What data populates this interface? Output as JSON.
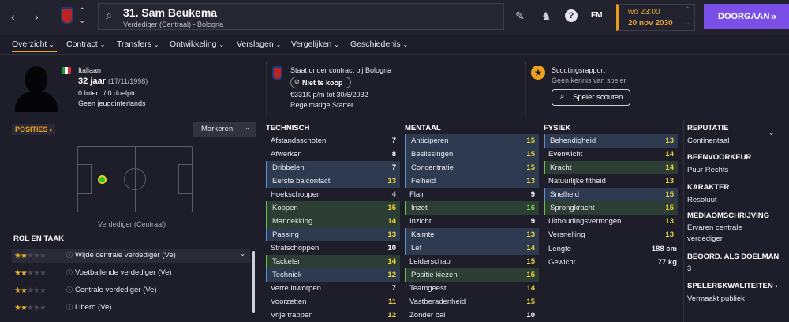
{
  "header": {
    "title": "31. Sam Beukema",
    "subtitle": "Verdediger (Centraal) - Bologna",
    "fm": "FM",
    "date_time": "wo 23:00",
    "date": "20 nov 2030",
    "continue": "DOORGAAN",
    "continue_icon": "»"
  },
  "nav": {
    "items": [
      "Overzicht",
      "Contract",
      "Transfers",
      "Ontwikkeling",
      "Verslagen",
      "Vergelijken",
      "Geschiedenis"
    ],
    "chev": "⌄"
  },
  "bio": {
    "nationality": "Italiaan",
    "age": "32 jaar",
    "dob": "(17/11/1998)",
    "caps": "0 Interl. / 0 doelptn.",
    "youth": "Geen jeugdinterlands"
  },
  "contract": {
    "status": "Staat onder contract bij Bologna",
    "transfer": "Niet te koop",
    "wage": "€331K p/m tot 30/6/2032",
    "role": "Regelmatige Starter"
  },
  "scouting": {
    "title": "Scoutingsrapport",
    "subtitle": "Geen kennis van speler",
    "button": "Speler scouten"
  },
  "positions": {
    "header": "POSITIES",
    "mark": "Markeren",
    "label": "Verdediger (Centraal)"
  },
  "roles": {
    "header": "ROL EN TAAK",
    "items": [
      {
        "name": "Wijde centrale verdediger (Ve)",
        "stars": 2.5
      },
      {
        "name": "Voetballende verdediger (Ve)",
        "stars": 2.5
      },
      {
        "name": "Centrale verdediger (Ve)",
        "stars": 2.5
      },
      {
        "name": "Libero (Ve)",
        "stars": 2.5
      }
    ]
  },
  "technisch": {
    "header": "TECHNISCH",
    "rows": [
      {
        "n": "Afstandsschoten",
        "v": "7",
        "h": ""
      },
      {
        "n": "Afwerken",
        "v": "8",
        "h": ""
      },
      {
        "n": "Dribbelen",
        "v": "7",
        "h": "b"
      },
      {
        "n": "Eerste balcontact",
        "v": "13",
        "h": "b"
      },
      {
        "n": "Hoekschoppen",
        "v": "4",
        "h": ""
      },
      {
        "n": "Koppen",
        "v": "15",
        "h": "g"
      },
      {
        "n": "Mandekking",
        "v": "14",
        "h": "g"
      },
      {
        "n": "Passing",
        "v": "13",
        "h": "b"
      },
      {
        "n": "Strafschoppen",
        "v": "10",
        "h": ""
      },
      {
        "n": "Tackelen",
        "v": "14",
        "h": "g"
      },
      {
        "n": "Techniek",
        "v": "12",
        "h": "b"
      },
      {
        "n": "Verre inworpen",
        "v": "7",
        "h": ""
      },
      {
        "n": "Voorzetten",
        "v": "11",
        "h": ""
      },
      {
        "n": "Vrije trappen",
        "v": "12",
        "h": ""
      }
    ]
  },
  "mentaal": {
    "header": "MENTAAL",
    "rows": [
      {
        "n": "Anticiperen",
        "v": "15",
        "h": "b"
      },
      {
        "n": "Beslissingen",
        "v": "15",
        "h": "b"
      },
      {
        "n": "Concentratie",
        "v": "15",
        "h": "b"
      },
      {
        "n": "Felheid",
        "v": "13",
        "h": "b"
      },
      {
        "n": "Flair",
        "v": "9",
        "h": ""
      },
      {
        "n": "Inzet",
        "v": "16",
        "h": "g"
      },
      {
        "n": "Inzicht",
        "v": "9",
        "h": ""
      },
      {
        "n": "Kalmte",
        "v": "13",
        "h": "b"
      },
      {
        "n": "Lef",
        "v": "14",
        "h": "b"
      },
      {
        "n": "Leiderschap",
        "v": "15",
        "h": ""
      },
      {
        "n": "Positie kiezen",
        "v": "15",
        "h": "g"
      },
      {
        "n": "Teamgeest",
        "v": "14",
        "h": ""
      },
      {
        "n": "Vastberadenheid",
        "v": "15",
        "h": ""
      },
      {
        "n": "Zonder bal",
        "v": "10",
        "h": ""
      }
    ]
  },
  "fysiek": {
    "header": "FYSIEK",
    "rows": [
      {
        "n": "Behendigheid",
        "v": "13",
        "h": "b"
      },
      {
        "n": "Evenwicht",
        "v": "14",
        "h": ""
      },
      {
        "n": "Kracht",
        "v": "14",
        "h": "g"
      },
      {
        "n": "Natuurlijke fitheid",
        "v": "13",
        "h": ""
      },
      {
        "n": "Snelheid",
        "v": "15",
        "h": "b"
      },
      {
        "n": "Sprongkracht",
        "v": "15",
        "h": "g"
      },
      {
        "n": "Uithoudingsvermogen",
        "v": "13",
        "h": ""
      },
      {
        "n": "Versnelling",
        "v": "13",
        "h": ""
      }
    ],
    "length_label": "Lengte",
    "length": "188 cm",
    "weight_label": "Gewicht",
    "weight": "77 kg"
  },
  "side": {
    "rep_h": "REPUTATIE",
    "rep": "Continentaal",
    "foot_h": "BEENVOORKEUR",
    "foot": "Puur Rechts",
    "char_h": "KARAKTER",
    "char": "Resoluut",
    "media_h": "MEDIAOMSCHRIJVING",
    "media1": "Ervaren centrale",
    "media2": "verdediger",
    "gk_h": "BEOORD. ALS DOELMAN",
    "gk": "3",
    "traits_h": "SPELERSKWALITEITEN",
    "traits": "Vermaakt publiek"
  },
  "colors": {
    "accent": "#f0a020",
    "button": "#7a4fe8",
    "good": "#e8b42a"
  }
}
